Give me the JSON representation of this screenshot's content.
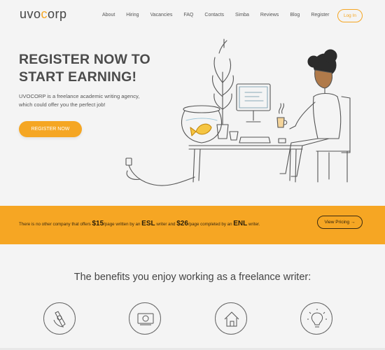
{
  "brand": {
    "logo_left": "uvo",
    "logo_accent": "c",
    "logo_right": "orp"
  },
  "nav": {
    "items": [
      "About",
      "Hiring",
      "Vacancies",
      "FAQ",
      "Contacts",
      "Simba",
      "Reviews",
      "Blog",
      "Register"
    ],
    "login_label": "Log In"
  },
  "hero": {
    "title_line1": "REGISTER NOW TO",
    "title_line2": "START EARNING!",
    "description": "UVOCORP is a freelance academic writing agency, which could offer you the perfect job!",
    "cta_label": "REGISTER NOW"
  },
  "band": {
    "t1": "There is no other company that offers ",
    "price1": "$15",
    "t2": "/page written by an ",
    "writer1": "ESL",
    "t3": " writer and ",
    "price2": "$26",
    "t4": "/page completed by an ",
    "writer2": "ENL",
    "t5": " writer.",
    "button_label": "View Pricing →"
  },
  "benefits": {
    "title": "The benefits you enjoy working as a freelance writer:",
    "icons": [
      "hand-icon",
      "money-icon",
      "house-icon",
      "lightbulb-icon"
    ]
  },
  "colors": {
    "accent": "#f5a623",
    "band": "#f6a623",
    "background": "#f4f4f4"
  }
}
